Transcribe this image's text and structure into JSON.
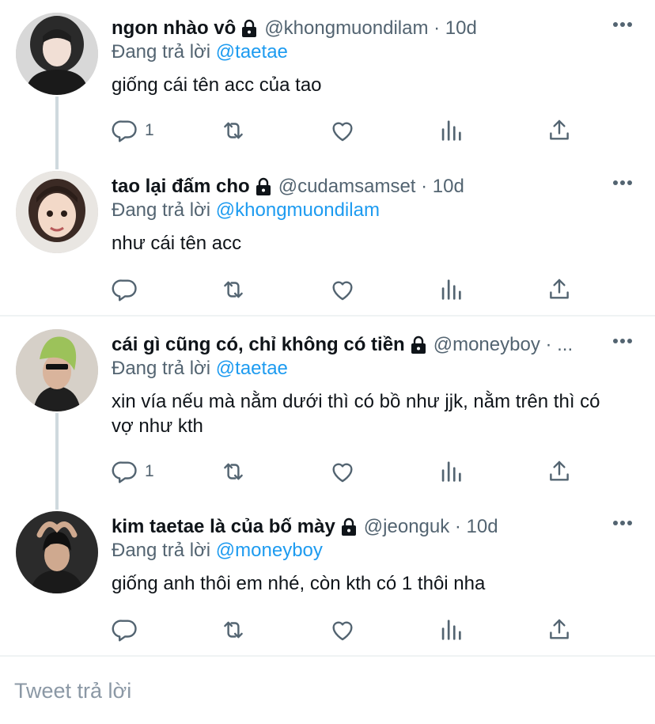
{
  "colors": {
    "accent": "#1d9bf0",
    "secondary_text": "#536471",
    "primary_text": "#0f1419"
  },
  "tweets": [
    {
      "name": "ngon nhào vô",
      "handle": "@khongmuondilam · 10d",
      "reply_prefix": "Đang trả lời ",
      "reply_to": "@taetae",
      "text": "giống cái tên acc của tao",
      "reply_count": "1",
      "avatar_icon": "avatar-photo"
    },
    {
      "name": "tao lại đấm cho",
      "handle": "@cudamsamset · 10d",
      "reply_prefix": "Đang trả lời ",
      "reply_to": "@khongmuondilam",
      "text": "như cái tên acc",
      "reply_count": "",
      "avatar_icon": "avatar-photo"
    },
    {
      "name": "cái gì cũng có, chỉ không có tiền",
      "handle": "@moneyboy · ...",
      "reply_prefix": "Đang trả lời ",
      "reply_to": "@taetae",
      "text": "xin vía nếu mà nằm dưới thì có bồ như jjk, nằm trên thì có vợ như kth",
      "reply_count": "1",
      "avatar_icon": "avatar-photo"
    },
    {
      "name": "kim taetae là của bố mày",
      "handle": "@jeonguk · 10d",
      "reply_prefix": "Đang trả lời ",
      "reply_to": "@moneyboy",
      "text": "giống anh thôi em nhé, còn kth có 1 thôi nha",
      "reply_count": "",
      "avatar_icon": "avatar-photo"
    }
  ],
  "compose": {
    "placeholder": "Tweet trả lời"
  }
}
